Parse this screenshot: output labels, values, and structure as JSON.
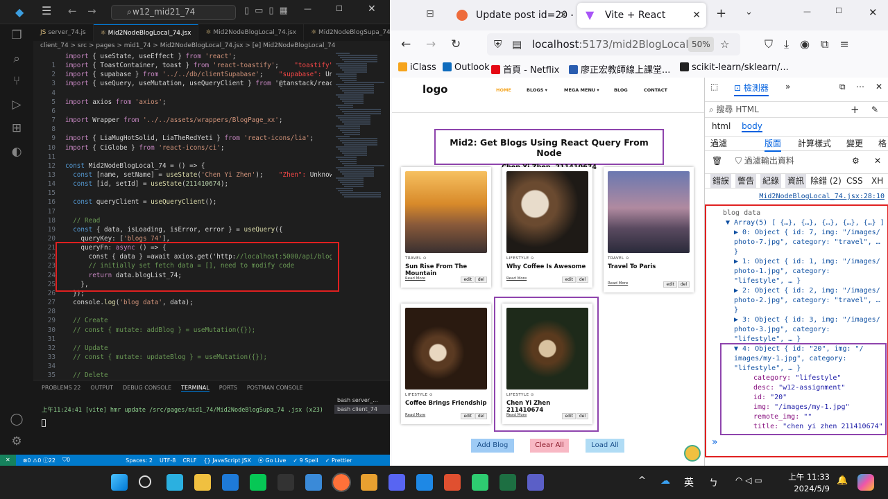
{
  "vscode": {
    "search": "w12_mid21_74",
    "tabs": [
      "server_74.js",
      "Mid2NodeBlogLocal_74.jsx",
      "Mid2NodeBlogLocal_74.jsx",
      "Mid2NodeBlogSupa_74.jsx"
    ],
    "breadcrumb": "client_74 > src > pages > mid1_74 > Mid2NodeBlogLocal_74.jsx > [e] Mid2NodeBlogLocal_74",
    "code_lines": [
      {
        "n": "",
        "t": "import { useState, useEffect } from 'react';"
      },
      {
        "n": "1",
        "t": "import { ToastContainer, toast } from 'react-toastify';    \"toastify\": U"
      },
      {
        "n": "2",
        "t": "import { supabase } from '../../db/clientSupabase';    \"supabase\": Unkno"
      },
      {
        "n": "3",
        "t": "import { useQuery, useMutation, useQueryClient } from '@tanstack/react-q"
      },
      {
        "n": "4",
        "t": ""
      },
      {
        "n": "5",
        "t": "import axios from 'axios';"
      },
      {
        "n": "6",
        "t": ""
      },
      {
        "n": "7",
        "t": "import Wrapper from '../../assets/wrappers/BlogPage_xx';"
      },
      {
        "n": "8",
        "t": ""
      },
      {
        "n": "9",
        "t": "import { LiaMugHotSolid, LiaTheRedYeti } from 'react-icons/lia';"
      },
      {
        "n": "10",
        "t": "import { CiGlobe } from 'react-icons/ci';"
      },
      {
        "n": "11",
        "t": ""
      },
      {
        "n": "12",
        "t": "const Mid2NodeBlogLocal_74 = () => {"
      },
      {
        "n": "13",
        "t": "  const [name, setName] = useState('Chen Yi Zhen');    \"Zhen\": Unknown w"
      },
      {
        "n": "14",
        "t": "  const [id, setId] = useState(211410674);"
      },
      {
        "n": "15",
        "t": ""
      },
      {
        "n": "16",
        "t": "  const queryClient = useQueryClient();"
      },
      {
        "n": "17",
        "t": ""
      },
      {
        "n": "18",
        "t": "  // Read"
      },
      {
        "n": "19",
        "t": "  const { data, isLoading, isError, error } = useQuery({"
      },
      {
        "n": "20",
        "t": "    queryKey: ['blogs_74'],"
      },
      {
        "n": "21",
        "t": "    queryFn: async () => {"
      },
      {
        "n": "22",
        "t": "      const { data } =await axios.get('http://localhost:5000/api/blogs')"
      },
      {
        "n": "23",
        "t": "      // initially set fetch data = [], need to modify code"
      },
      {
        "n": "24",
        "t": "      return data.blogList_74;"
      },
      {
        "n": "25",
        "t": "    },"
      },
      {
        "n": "26",
        "t": "  });"
      },
      {
        "n": "27",
        "t": "  console.log('blog data', data);"
      },
      {
        "n": "28",
        "t": ""
      },
      {
        "n": "29",
        "t": "  // Create"
      },
      {
        "n": "30",
        "t": "  // const { mutate: addBlog } = useMutation({});"
      },
      {
        "n": "31",
        "t": ""
      },
      {
        "n": "32",
        "t": "  // Update"
      },
      {
        "n": "33",
        "t": "  // const { mutate: updateBlog } = useMutation({});"
      },
      {
        "n": "34",
        "t": ""
      },
      {
        "n": "35",
        "t": "  // Delete"
      }
    ],
    "panel_tabs": [
      "PROBLEMS 22",
      "OUTPUT",
      "DEBUG CONSOLE",
      "TERMINAL",
      "PORTS",
      "POSTMAN CONSOLE"
    ],
    "terminal_line": "上午11:24:41 [vite] hmr update /src/pages/mid1_74/Mid2NodeBlogSupa_74 .jsx (x23)",
    "terminals": [
      "bash server_...",
      "bash client_74"
    ],
    "status": [
      "⊗0 ⚠0 ⓘ22",
      "⛉0",
      "Spaces: 2",
      "UTF-8",
      "CRLF",
      "{} JavaScript JSX",
      "⦿ Go Live",
      "✓ 9 Spell",
      "✓ Prettier"
    ]
  },
  "firefox": {
    "tabs": [
      "Update post id=20 - M",
      "Vite + React"
    ],
    "url_host": "localhost",
    "url_rest": ":5173/mid2BlogLocal_74",
    "zoom": "50%",
    "bookmarks": [
      "iClass",
      "Outlook",
      "首頁 - Netflix",
      "廖正宏教師線上課堂...",
      "scikit-learn/sklearn/..."
    ]
  },
  "site": {
    "logo": "logo",
    "nav": [
      "HOME",
      "BLOGS ▾",
      "MEGA MENU ▾",
      "BLOG",
      "CONTACT"
    ],
    "heading": "Mid2: Get Blogs Using React Query From Node",
    "subheading": "Chen Yi Zhen, 211410674",
    "cards": [
      {
        "cat": "TRAVEL ⊙",
        "title": "Sun Rise From The Mountain"
      },
      {
        "cat": "LIFESTYLE ⊙",
        "title": "Why Coffee Is Awesome"
      },
      {
        "cat": "TRAVEL ⊙",
        "title": "Travel To Paris"
      },
      {
        "cat": "LIFESTYLE ⊙",
        "title": "Coffee Brings Friendship"
      },
      {
        "cat": "LIFESTYLE ⊙",
        "title": "Chen Yi Zhen 211410674"
      }
    ],
    "read_more": "Read More",
    "edit": "edit",
    "del": "del",
    "buttons": [
      "Add Blog",
      "Clear All",
      "Load All"
    ]
  },
  "devtools": {
    "inspector": "檢測器",
    "search_html": "搜尋 HTML",
    "crumbs": [
      "html",
      "body"
    ],
    "style_tabs": [
      "過濾",
      "版面",
      "計算樣式",
      "變更",
      "格"
    ],
    "filter_output": "過濾輸出資料",
    "levels": [
      "錯誤",
      "警告",
      "紀錄",
      "資訊",
      "除錯 (2)",
      "CSS",
      "XH"
    ],
    "source": "Mid2NodeBlogLocal_74.jsx:28:10",
    "log_label": "blog data",
    "array": "▼ Array(5) [ {…}, {…}, {…}, {…}, {…} ]",
    "items": [
      "▶ 0: Object { id: 7, img: \"/images/",
      "photo-7.jpg\", category: \"travel\", …",
      "}",
      "▶ 1: Object { id: 1, img: \"/images/",
      "photo-1.jpg\", category:",
      "\"lifestyle\", … }",
      "▶ 2: Object { id: 2, img: \"/images/",
      "photo-2.jpg\", category: \"travel\", …",
      "}",
      "▶ 3: Object { id: 3, img: \"/images/",
      "photo-3.jpg\", category:",
      "\"lifestyle\", … }",
      "▼ 4: Object { id: \"20\", img: \"/",
      "images/my-1.jpg\", category:",
      "\"lifestyle\", … }"
    ],
    "props": [
      [
        "category",
        "\"lifestyle\""
      ],
      [
        "desc",
        "\"w12-assignment\""
      ],
      [
        "id",
        "\"20\""
      ],
      [
        "img",
        "\"/images/my-1.jpg\""
      ],
      [
        "remote_img",
        "\"\""
      ],
      [
        "title",
        "\"chen yi zhen 211410674\""
      ]
    ]
  },
  "taskbar": {
    "time": "上午 11:33",
    "date": "2024/5/9",
    "lang": "英"
  },
  "colors": {
    "vscode_bg": "#1e1e1e",
    "status": "#007acc",
    "highlight_red": "#e02020",
    "highlight_purple": "#8e44ad"
  }
}
